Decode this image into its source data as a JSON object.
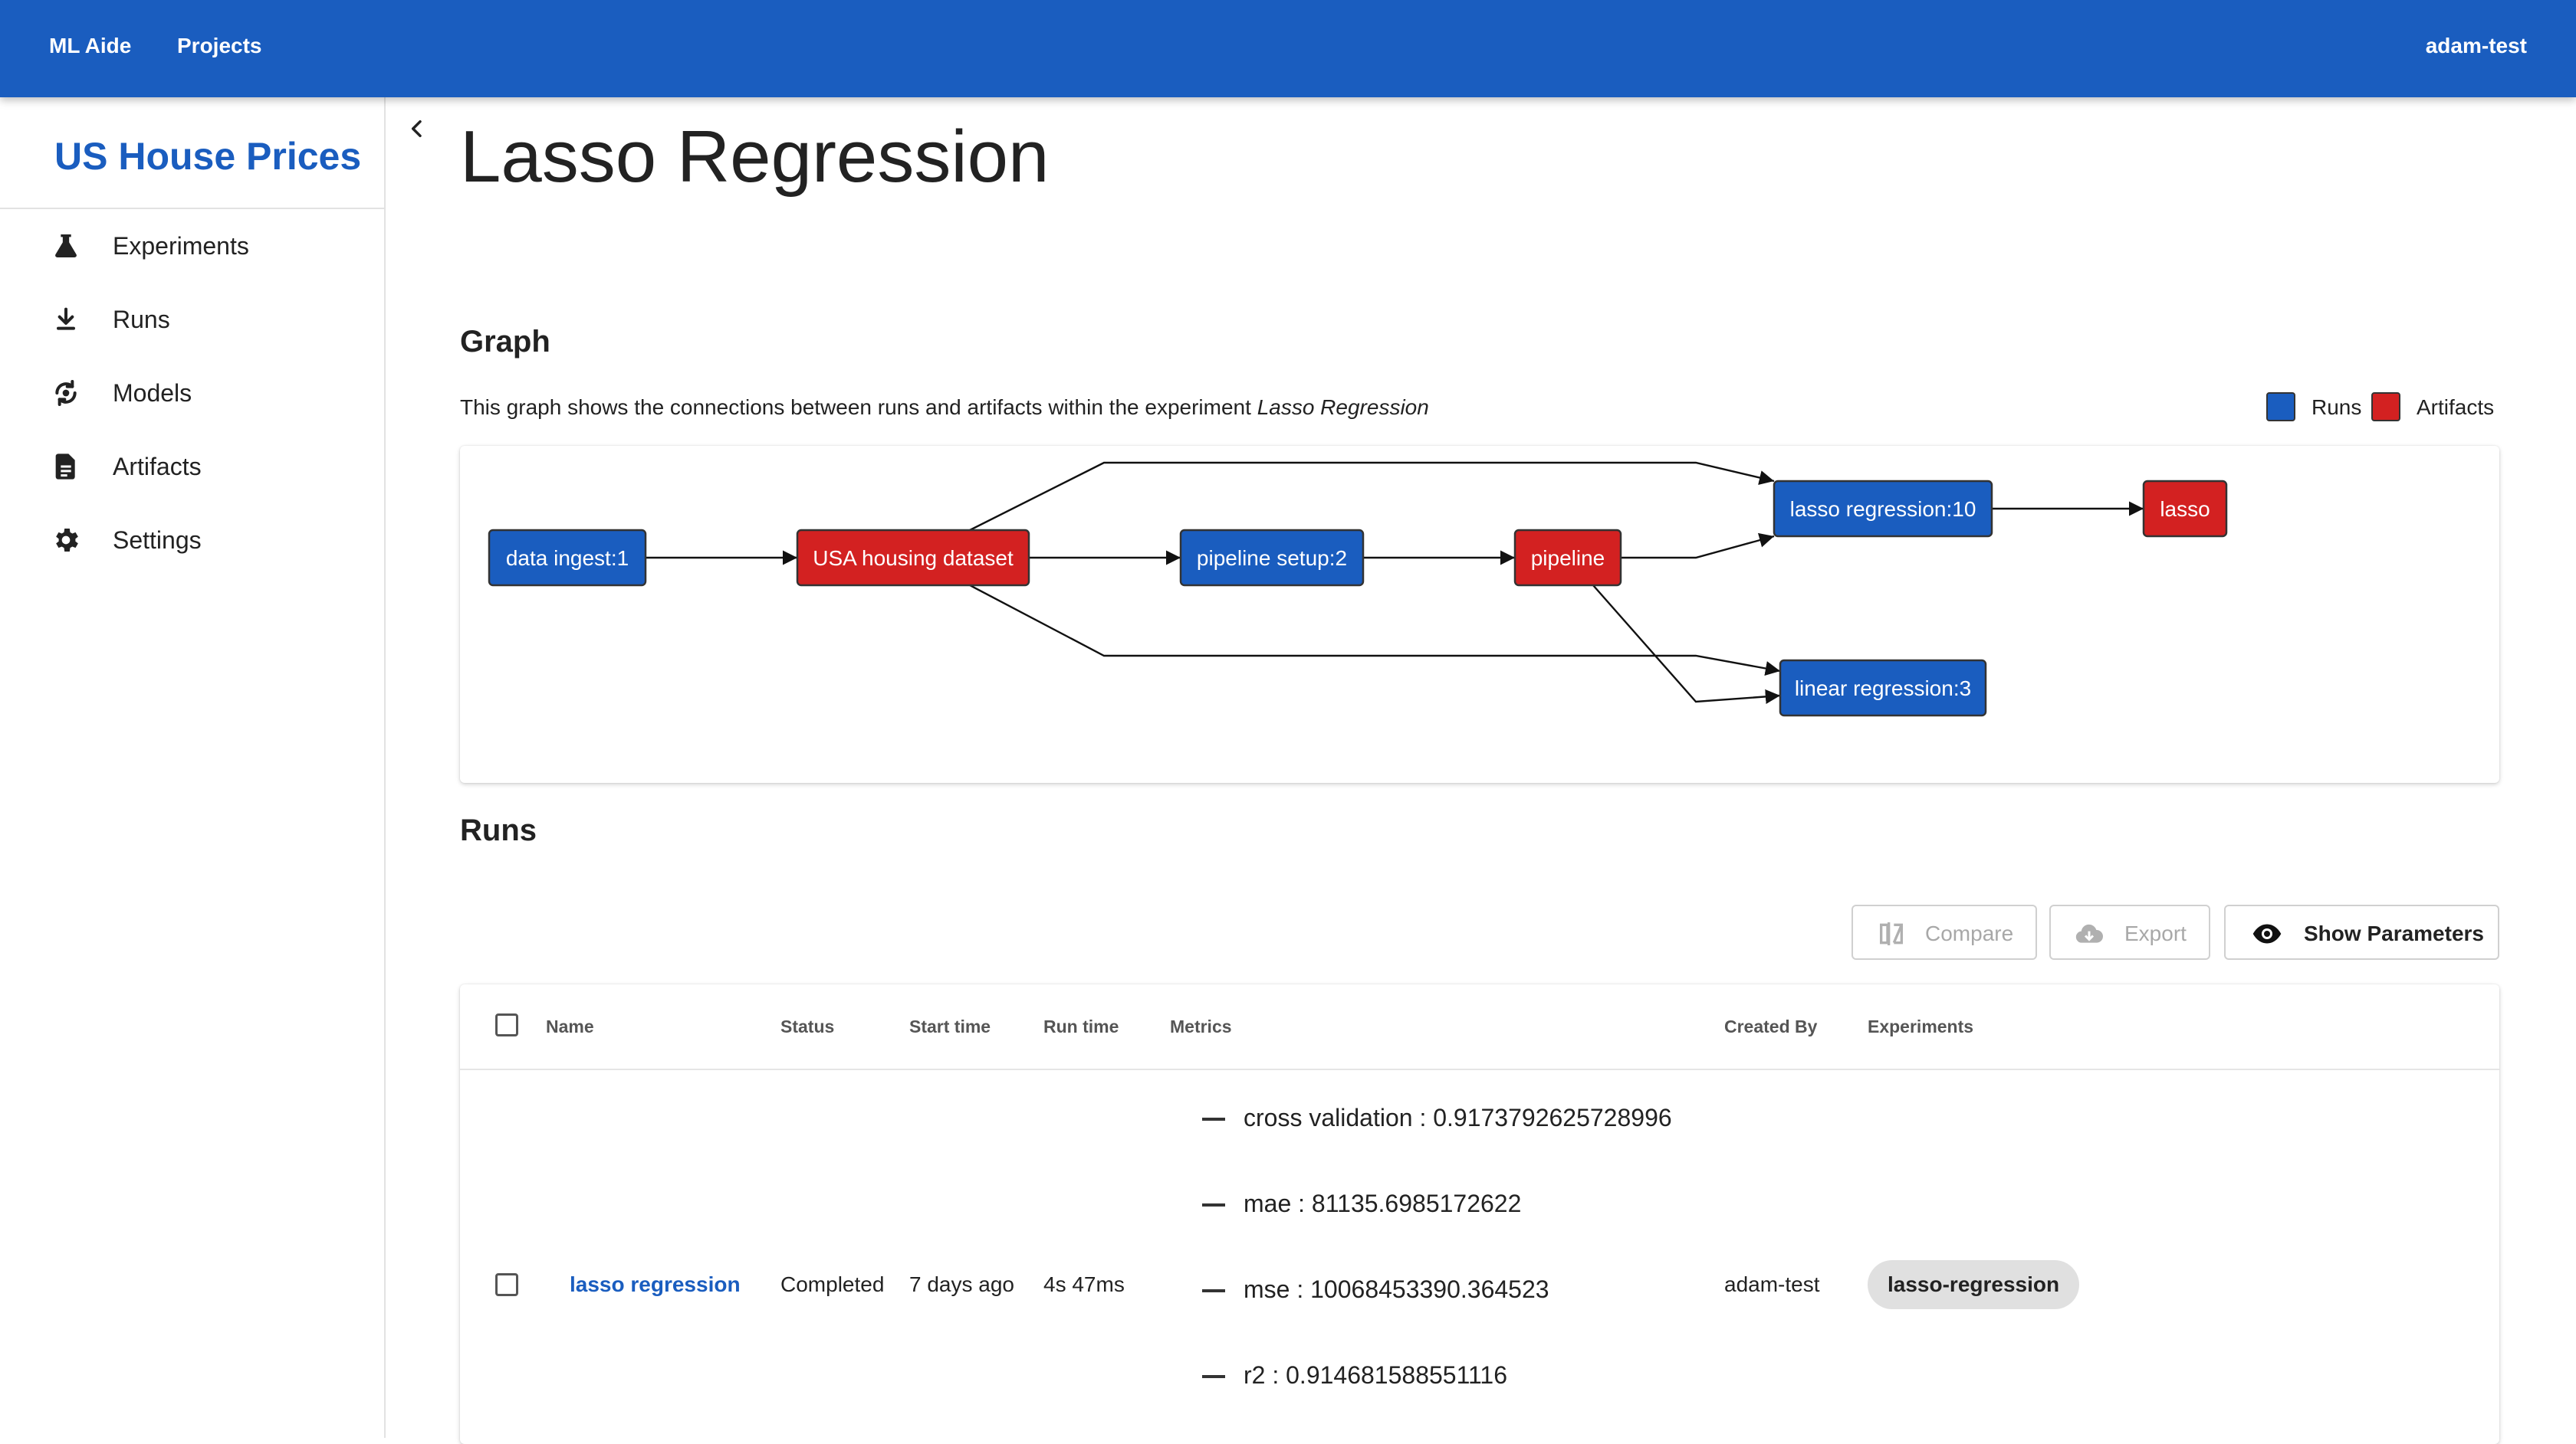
{
  "topbar": {
    "brand": "ML Aide",
    "projects_link": "Projects",
    "user": "adam-test"
  },
  "sidebar": {
    "project_title": "US House Prices",
    "items": [
      {
        "label": "Experiments",
        "icon": "flask-icon"
      },
      {
        "label": "Runs",
        "icon": "download-arrow-icon"
      },
      {
        "label": "Models",
        "icon": "model-cycle-icon"
      },
      {
        "label": "Artifacts",
        "icon": "document-icon"
      },
      {
        "label": "Settings",
        "icon": "gear-icon"
      }
    ]
  },
  "page": {
    "title": "Lasso Regression"
  },
  "graph": {
    "heading": "Graph",
    "description_prefix": "This graph shows the connections between runs and artifacts within the experiment ",
    "description_experiment": "Lasso Regression",
    "legend": {
      "runs_label": "Runs",
      "artifacts_label": "Artifacts",
      "runs_color": "#1a5dbf",
      "artifacts_color": "#d32121"
    },
    "nodes": [
      {
        "id": "n1",
        "label": "data ingest:1",
        "kind": "run"
      },
      {
        "id": "n2",
        "label": "USA housing dataset",
        "kind": "artifact"
      },
      {
        "id": "n3",
        "label": "pipeline setup:2",
        "kind": "run"
      },
      {
        "id": "n4",
        "label": "pipeline",
        "kind": "artifact"
      },
      {
        "id": "n5",
        "label": "lasso regression:10",
        "kind": "run"
      },
      {
        "id": "n6",
        "label": "lasso",
        "kind": "artifact"
      },
      {
        "id": "n7",
        "label": "linear regression:3",
        "kind": "run"
      }
    ],
    "edges": [
      [
        "n1",
        "n2"
      ],
      [
        "n2",
        "n3"
      ],
      [
        "n3",
        "n4"
      ],
      [
        "n2",
        "n5"
      ],
      [
        "n4",
        "n5"
      ],
      [
        "n5",
        "n6"
      ],
      [
        "n2",
        "n7"
      ],
      [
        "n4",
        "n7"
      ]
    ]
  },
  "runs": {
    "heading": "Runs",
    "toolbar": {
      "compare_label": "Compare",
      "export_label": "Export",
      "show_parameters_label": "Show Parameters"
    },
    "columns": {
      "name": "Name",
      "status": "Status",
      "start_time": "Start time",
      "run_time": "Run time",
      "metrics": "Metrics",
      "created_by": "Created By",
      "experiments": "Experiments"
    },
    "rows": [
      {
        "name": "lasso regression",
        "status": "Completed",
        "start_time": "7 days ago",
        "run_time": "4s 47ms",
        "metrics": [
          "cross validation : 0.9173792625728996",
          "mae : 81135.6985172622",
          "mse : 10068453390.364523",
          "r2 : 0.914681588551116"
        ],
        "created_by": "adam-test",
        "experiment": "lasso-regression"
      }
    ]
  }
}
